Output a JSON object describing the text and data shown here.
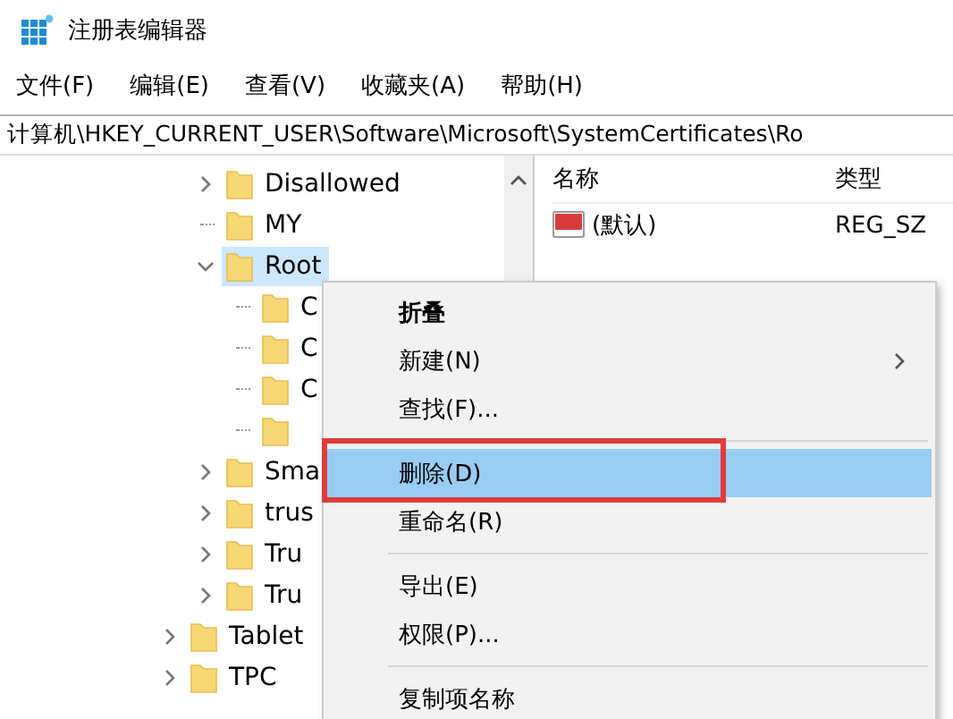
{
  "window": {
    "title": "注册表编辑器"
  },
  "menu_bar": [
    "文件(F)",
    "编辑(E)",
    "查看(V)",
    "收藏夹(A)",
    "帮助(H)"
  ],
  "address": "计算机\\HKEY_CURRENT_USER\\Software\\Microsoft\\SystemCertificates\\Ro",
  "tree": {
    "items": [
      {
        "kind": "hidden",
        "children": [
          {
            "kind": "branch",
            "label": "Disallowed",
            "expanded": false,
            "selected": false
          },
          {
            "kind": "leaf",
            "label": "MY",
            "selected": false
          },
          {
            "kind": "branch",
            "label": "Root",
            "expanded": true,
            "selected": true,
            "children": [
              {
                "kind": "leaf",
                "label": "C",
                "selected": false
              },
              {
                "kind": "leaf",
                "label": "C",
                "selected": false
              },
              {
                "kind": "leaf",
                "label": "C",
                "selected": false
              },
              {
                "kind": "leaf",
                "selected": false
              }
            ]
          },
          {
            "kind": "branch",
            "label": "Sma",
            "expanded": false,
            "selected": false
          },
          {
            "kind": "branch",
            "label": "trus",
            "expanded": false,
            "selected": false
          },
          {
            "kind": "branch",
            "label": "Tru",
            "expanded": false,
            "selected": false
          },
          {
            "kind": "branch",
            "label": "Tru",
            "expanded": false,
            "selected": false
          }
        ]
      },
      {
        "kind": "branch",
        "label": "Tablet",
        "expanded": false,
        "selected": false
      },
      {
        "kind": "branch",
        "label": "TPC",
        "expanded": false,
        "selected": false
      }
    ]
  },
  "values": {
    "columns": [
      "名称",
      "类型"
    ],
    "rows": [
      {
        "name": "(默认)",
        "type": "REG_SZ"
      }
    ]
  },
  "context_menu": [
    {
      "kind": "item",
      "label": "折叠",
      "default": true,
      "submenu": false,
      "highlighted": false,
      "annotated": false
    },
    {
      "kind": "item",
      "label": "新建(N)",
      "default": false,
      "submenu": true,
      "highlighted": false,
      "annotated": false
    },
    {
      "kind": "item",
      "label": "查找(F)...",
      "default": false,
      "submenu": false,
      "highlighted": false,
      "annotated": false
    },
    {
      "kind": "separator"
    },
    {
      "kind": "item",
      "label": "删除(D)",
      "default": false,
      "submenu": false,
      "highlighted": true,
      "annotated": true
    },
    {
      "kind": "item",
      "label": "重命名(R)",
      "default": false,
      "submenu": false,
      "highlighted": false,
      "annotated": false
    },
    {
      "kind": "separator"
    },
    {
      "kind": "item",
      "label": "导出(E)",
      "default": false,
      "submenu": false,
      "highlighted": false,
      "annotated": false
    },
    {
      "kind": "item",
      "label": "权限(P)...",
      "default": false,
      "submenu": false,
      "highlighted": false,
      "annotated": false
    },
    {
      "kind": "separator"
    },
    {
      "kind": "item",
      "label": "复制项名称",
      "default": false,
      "submenu": false,
      "highlighted": false,
      "annotated": false
    }
  ]
}
